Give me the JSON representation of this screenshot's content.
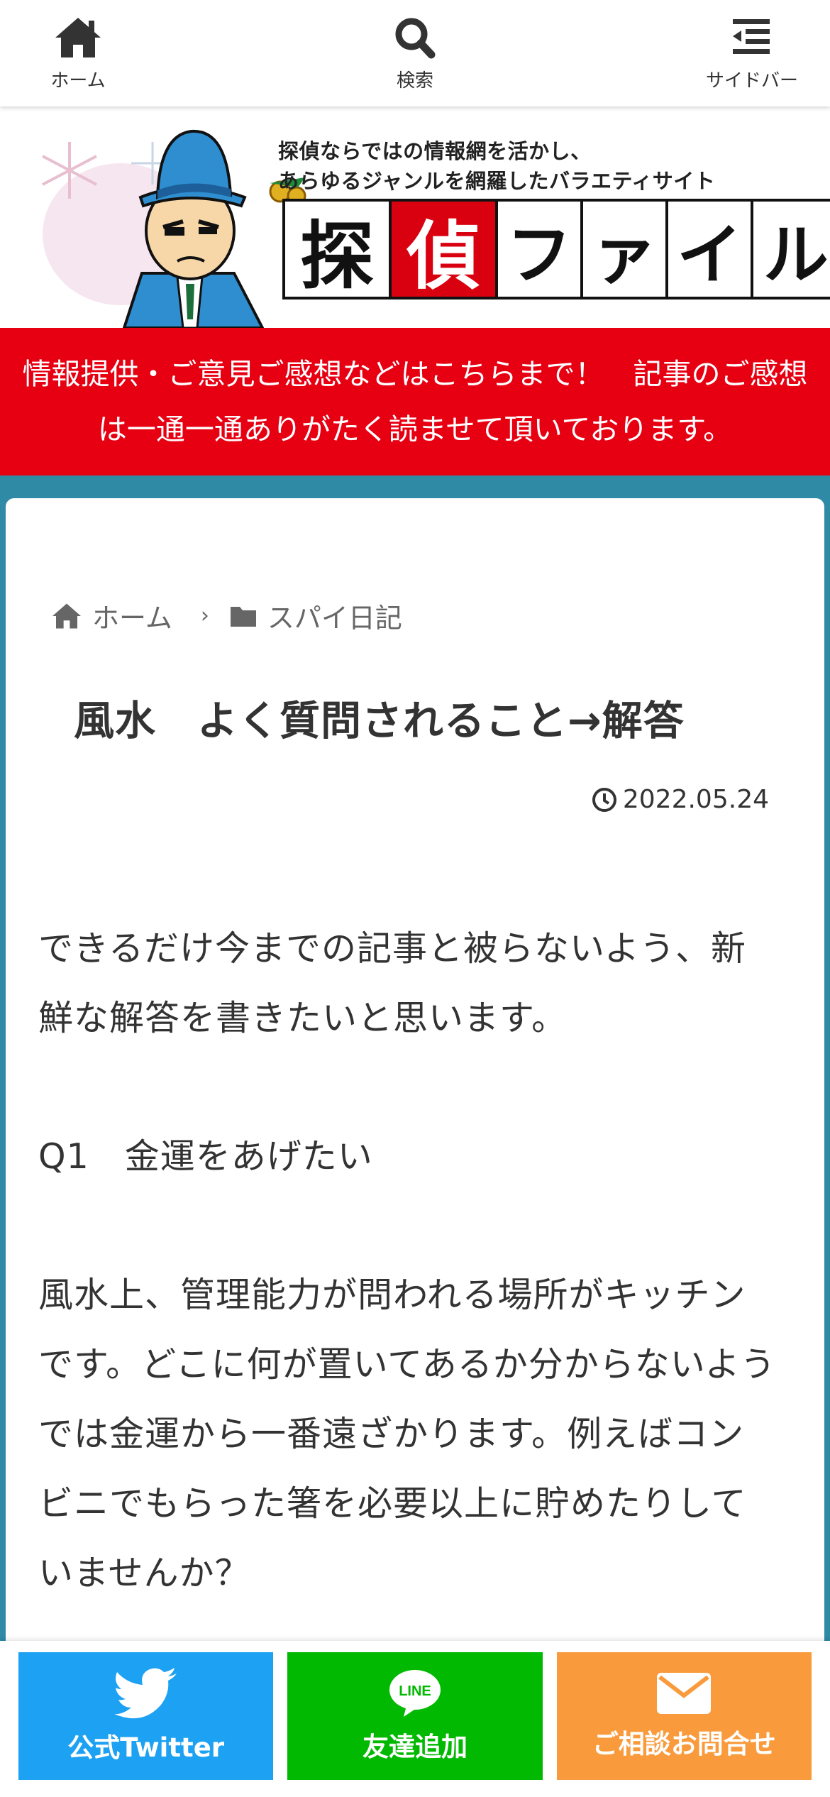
{
  "nav": {
    "home": {
      "label": "ホーム",
      "icon": "home-icon"
    },
    "search": {
      "label": "検索",
      "icon": "search-icon"
    },
    "sidebar": {
      "label": "サイドバー",
      "icon": "sidebar-menu-icon"
    }
  },
  "header": {
    "tagline_line1": "探偵ならではの情報網を活かし、",
    "tagline_line2": "あらゆるジャンルを網羅したバラエティサイト",
    "logo_chars": [
      "探",
      "偵",
      "フ",
      "ァ",
      "イ",
      "ル"
    ]
  },
  "notice": {
    "text": "情報提供・ご意見ご感想などはこちらまで！　記事のご感想は一通一通ありがたく読ませて頂いております。"
  },
  "breadcrumb": {
    "home": "ホーム",
    "category": "スパイ日記"
  },
  "post": {
    "title": "風水　よく質問されること→解答",
    "date": "2022.05.24",
    "paragraphs": [
      "できるだけ今までの記事と被らないよう、新鮮な解答を書きたいと思います。",
      "Q1　金運をあげたい",
      "風水上、管理能力が問われる場所がキッチンです。どこに何が置いてあるか分からないようでは金運から一番遠ざかります。例えばコンビニでもらった箸を必要以上に貯めたりしていませんか？"
    ]
  },
  "footer_bar": {
    "twitter": "公式Twitter",
    "line": "友達追加",
    "line_badge": "LINE",
    "contact": "ご相談お問合せ"
  },
  "colors": {
    "accent": "#2f8aa6",
    "notice_red": "#e60012",
    "twitter": "#1da1f2",
    "line": "#00b900",
    "contact": "#f99b3c"
  }
}
